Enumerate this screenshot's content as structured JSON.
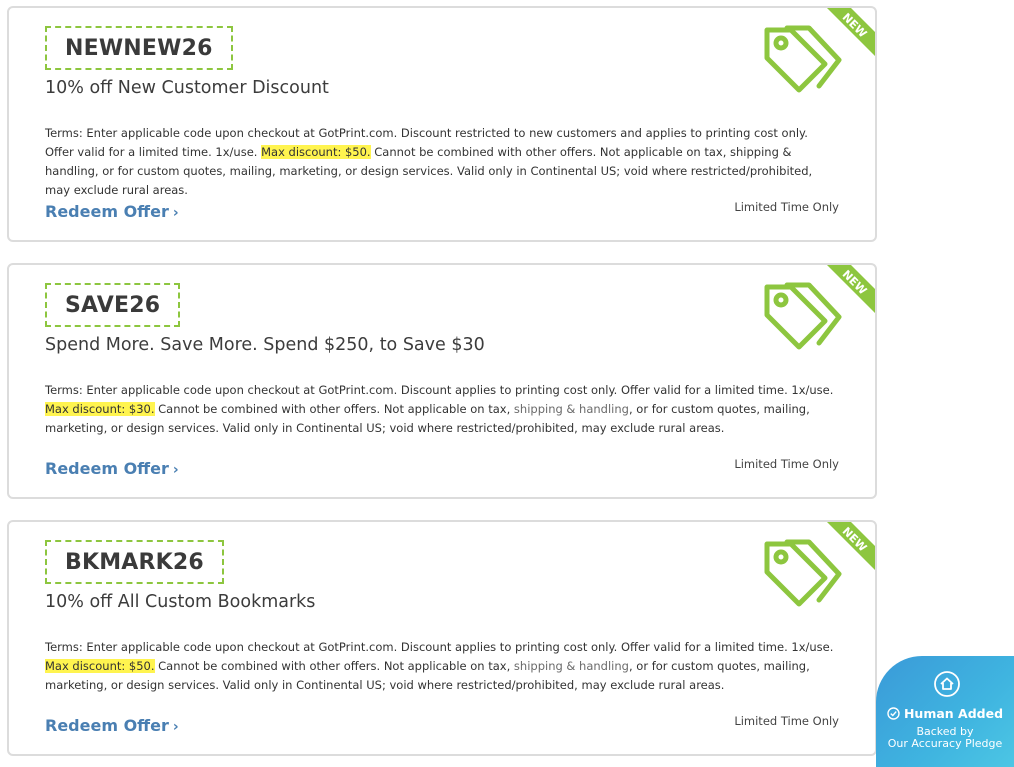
{
  "coupons": [
    {
      "code": "NEWNEW26",
      "title": "10% off New Customer Discount",
      "terms_pre": "Terms: Enter applicable code upon checkout at GotPrint.com. Discount restricted to new customers and applies to printing cost only. Offer valid for a limited time. 1x/use. ",
      "terms_highlight": "Max discount: $50.",
      "terms_mid": " Cannot be combined with other offers. Not applicable on tax, shipping & handling, or for custom quotes, mailing, marketing, or design services. Valid only in Continental US; void where restricted/prohibited, may exclude rural areas.",
      "terms_link": "",
      "terms_post": "",
      "redeem_label": "Redeem Offer",
      "limited": "Limited Time Only",
      "ribbon": "NEW"
    },
    {
      "code": "SAVE26",
      "title": "Spend More. Save More. Spend $250, to Save $30",
      "terms_pre": "Terms: Enter applicable code upon checkout at GotPrint.com. Discount applies to printing cost only. Offer valid for a limited time. 1x/use. ",
      "terms_highlight": "Max discount: $30.",
      "terms_mid": " Cannot be combined with other offers. Not applicable on tax, ",
      "terms_link": "shipping & handling",
      "terms_post": ", or for custom quotes, mailing, marketing, or design services. Valid only in Continental US; void where restricted/prohibited, may exclude rural areas.",
      "redeem_label": "Redeem Offer",
      "limited": "Limited Time Only",
      "ribbon": "NEW"
    },
    {
      "code": "BKMARK26",
      "title": "10% off All Custom Bookmarks",
      "terms_pre": "Terms: Enter applicable code upon checkout at GotPrint.com. Discount applies to printing cost only. Offer valid for a limited time. 1x/use. ",
      "terms_highlight": "Max discount: $50.",
      "terms_mid": " Cannot be combined with other offers. Not applicable on tax, ",
      "terms_link": "shipping & handling",
      "terms_post": ", or for custom quotes, mailing, marketing, or design services. Valid only in Continental US; void where restricted/prohibited, may exclude rural areas.",
      "redeem_label": "Redeem Offer",
      "limited": "Limited Time Only",
      "ribbon": "NEW"
    }
  ],
  "badge": {
    "title": "Human Added",
    "sub_line1": "Backed by",
    "sub_line2": "Our Accuracy Pledge"
  },
  "colors": {
    "accent_green": "#8dc63f",
    "link_blue": "#4a7fb2",
    "highlight": "#fff44f",
    "badge_blue": "#3fb4e0"
  },
  "icons": {
    "tag": "tag-icon",
    "chevron": "chevron-right-icon",
    "home": "home-icon",
    "check": "check-circle-icon"
  }
}
